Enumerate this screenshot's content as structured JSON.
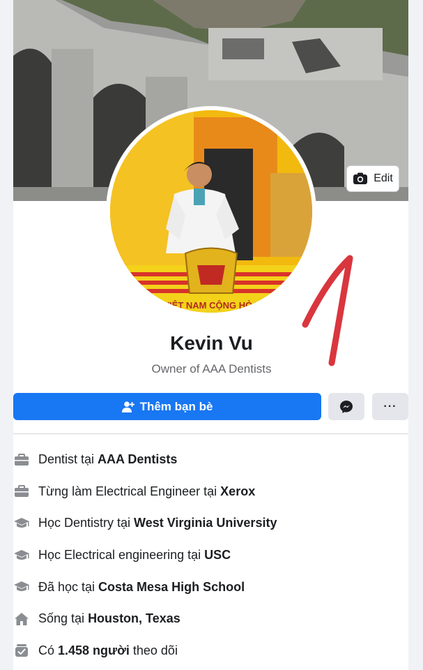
{
  "cover": {
    "edit_label": "Edit"
  },
  "profile": {
    "name": "Kevin Vu",
    "bio": "Owner of AAA Dentists",
    "avatar_caption": "VIỆT NAM CỘNG HÒA"
  },
  "actions": {
    "add_friend_label": "Thêm bạn bè",
    "more_label": "···"
  },
  "annotation": {
    "text": "1",
    "color": "#d9363e"
  },
  "intro": [
    {
      "icon": "briefcase-icon",
      "prefix": "Dentist tại ",
      "bold": "AAA Dentists",
      "suffix": ""
    },
    {
      "icon": "briefcase-icon",
      "prefix": "Từng làm Electrical Engineer tại ",
      "bold": "Xerox",
      "suffix": ""
    },
    {
      "icon": "graduation-cap-icon",
      "prefix": "Học Dentistry tại ",
      "bold": "West Virginia University",
      "suffix": ""
    },
    {
      "icon": "graduation-cap-icon",
      "prefix": "Học Electrical engineering tại ",
      "bold": "USC",
      "suffix": ""
    },
    {
      "icon": "graduation-cap-icon",
      "prefix": "Đã học tại ",
      "bold": "Costa Mesa High School",
      "suffix": ""
    },
    {
      "icon": "home-icon",
      "prefix": "Sống tại ",
      "bold": "Houston, Texas",
      "suffix": ""
    },
    {
      "icon": "followers-icon",
      "prefix": "Có ",
      "bold": "1.458 người",
      "suffix": " theo dõi"
    }
  ],
  "colors": {
    "primary": "#1877f2",
    "secondary_button": "#e4e6eb",
    "muted_text": "#65676b"
  }
}
